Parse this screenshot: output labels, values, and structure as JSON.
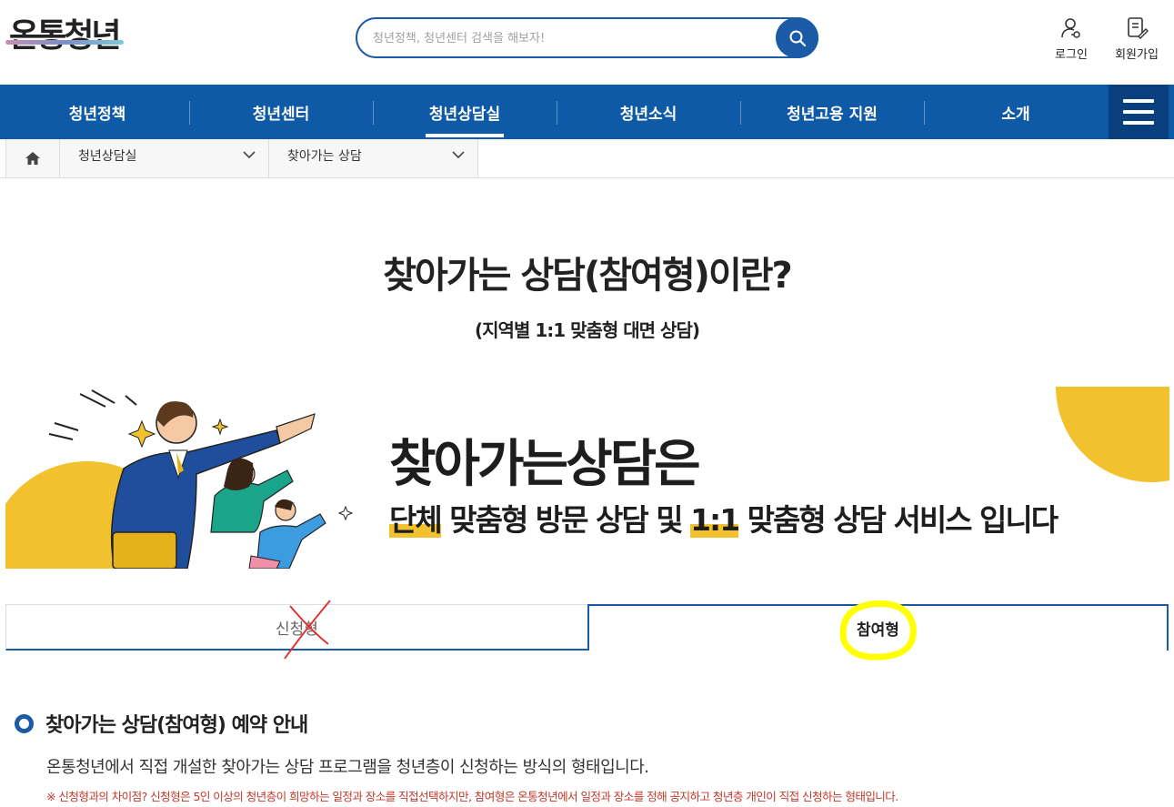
{
  "header": {
    "logo_text": "온통청년",
    "search": {
      "placeholder": "청년정책, 청년센터 검색을 해보자!"
    },
    "login_label": "로그인",
    "join_label": "회원가입"
  },
  "nav": {
    "items": [
      {
        "label": "청년정책"
      },
      {
        "label": "청년센터"
      },
      {
        "label": "청년상담실"
      },
      {
        "label": "청년소식"
      },
      {
        "label": "청년고용 지원"
      },
      {
        "label": "소개"
      }
    ],
    "active_index": 2
  },
  "breadcrumb": {
    "level1": "청년상담실",
    "level2": "찾아가는 상담"
  },
  "page": {
    "title": "찾아가는 상담(참여형)이란?",
    "subtitle": "(지역별 1:1 맞춤형 대면 상담)"
  },
  "banner": {
    "headline": "찾아가는상담은",
    "line_part1": "단체",
    "line_part2": " 맞춤형 방문 상담 및 ",
    "line_part3": "1:1",
    "line_part4": " 맞춤형 상담 서비스 입니다"
  },
  "tabs": [
    {
      "label": "신청형",
      "active": false
    },
    {
      "label": "참여형",
      "active": true
    }
  ],
  "info": {
    "section_title": "찾아가는 상담(참여형) 예약 안내",
    "description": "온통청년에서 직접 개설한 찾아가는 상담 프로그램을 청년층이 신청하는 방식의 형태입니다.",
    "note": "※  신청형과의 차이점? 신청형은 5인 이상의 청년층이 희망하는 일정과 장소를 직접선택하지만, 참여형은 온통청년에서 일정과 장소를 정해 공지하고 청년층 개인이 직접 신청하는 형태입니다."
  },
  "colors": {
    "primary": "#0f5aa6",
    "menu_dark": "#0a3f7d",
    "accent_yellow": "#f2c12e",
    "note_red": "#c0392b"
  }
}
